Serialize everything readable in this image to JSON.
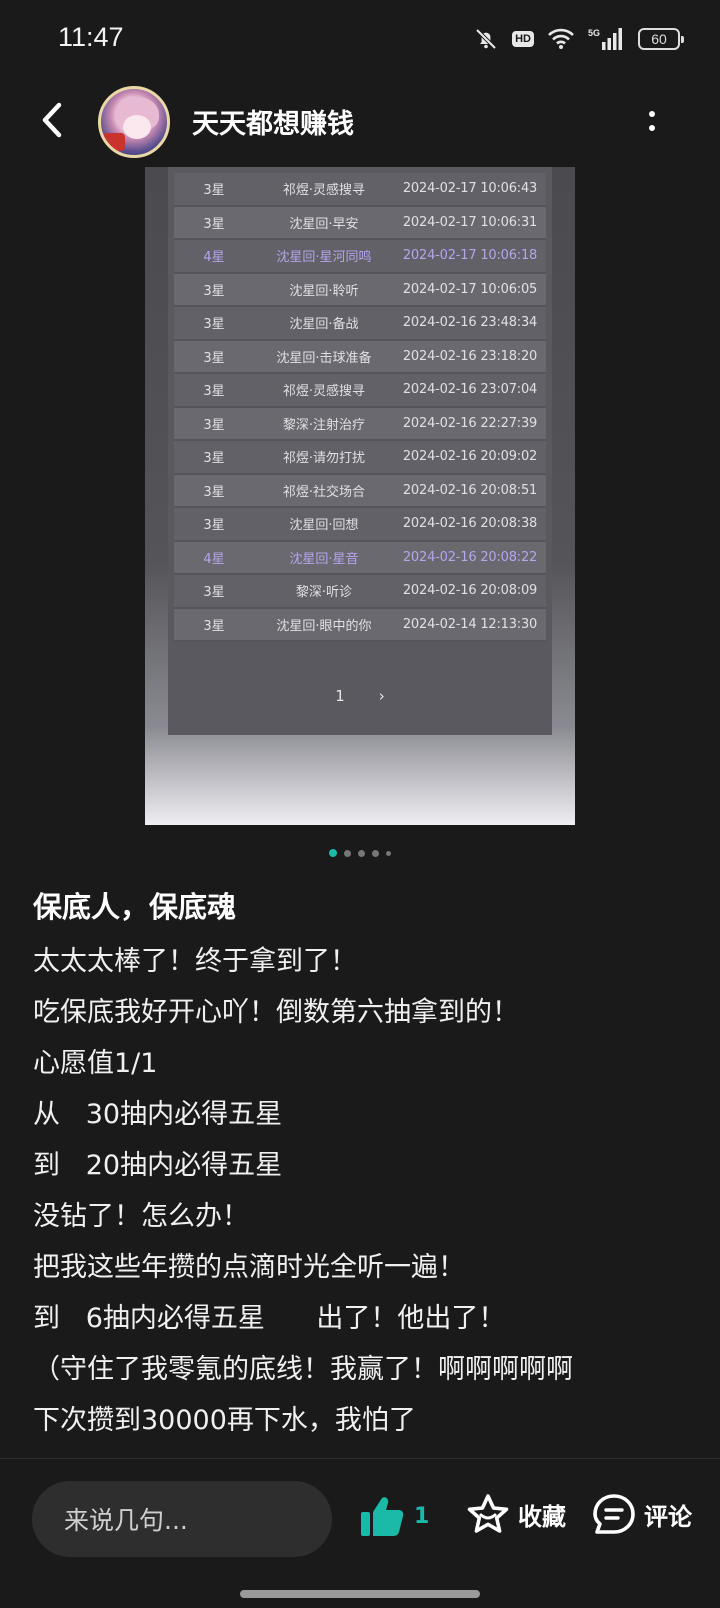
{
  "status_bar": {
    "time": "11:47",
    "hd": "HD",
    "network": "5G",
    "battery": "60"
  },
  "header": {
    "username": "天天都想赚钱"
  },
  "records": [
    {
      "star": "3星",
      "name": "祁煜·灵感搜寻",
      "time": "2024-02-17 10:06:43",
      "four": false
    },
    {
      "star": "3星",
      "name": "沈星回·早安",
      "time": "2024-02-17 10:06:31",
      "four": false
    },
    {
      "star": "4星",
      "name": "沈星回·星河同鸣",
      "time": "2024-02-17 10:06:18",
      "four": true
    },
    {
      "star": "3星",
      "name": "沈星回·聆听",
      "time": "2024-02-17 10:06:05",
      "four": false
    },
    {
      "star": "3星",
      "name": "沈星回·备战",
      "time": "2024-02-16 23:48:34",
      "four": false
    },
    {
      "star": "3星",
      "name": "沈星回·击球准备",
      "time": "2024-02-16 23:18:20",
      "four": false
    },
    {
      "star": "3星",
      "name": "祁煜·灵感搜寻",
      "time": "2024-02-16 23:07:04",
      "four": false
    },
    {
      "star": "3星",
      "name": "黎深·注射治疗",
      "time": "2024-02-16 22:27:39",
      "four": false
    },
    {
      "star": "3星",
      "name": "祁煜·请勿打扰",
      "time": "2024-02-16 20:09:02",
      "four": false
    },
    {
      "star": "3星",
      "name": "祁煜·社交场合",
      "time": "2024-02-16 20:08:51",
      "four": false
    },
    {
      "star": "3星",
      "name": "沈星回·回想",
      "time": "2024-02-16 20:08:38",
      "four": false
    },
    {
      "star": "4星",
      "name": "沈星回·星音",
      "time": "2024-02-16 20:08:22",
      "four": true
    },
    {
      "star": "3星",
      "name": "黎深·听诊",
      "time": "2024-02-16 20:08:09",
      "four": false
    },
    {
      "star": "3星",
      "name": "沈星回·眼中的你",
      "time": "2024-02-14 12:13:30",
      "four": false
    }
  ],
  "pager": {
    "page": "1",
    "next": "›"
  },
  "carousel": {
    "count": 5,
    "active": 0
  },
  "post": {
    "title": "保底人，保底魂",
    "lines": [
      "太太太棒了！终于拿到了！",
      "吃保底我好开心吖！倒数第六抽拿到的！",
      "心愿值1/1",
      "从   30抽内必得五星",
      "到   20抽内必得五星",
      "没钻了！怎么办！",
      "把我这些年攒的点滴时光全听一遍！",
      "到   6抽内必得五星      出了！他出了！",
      "（守住了我零氪的底线！我赢了！啊啊啊啊啊",
      "下次攒到30000再下水，我怕了"
    ]
  },
  "bottom_bar": {
    "comment_placeholder": "来说几句...",
    "like_count": "1",
    "favorite_label": "收藏",
    "comment_label": "评论"
  },
  "colors": {
    "accent": "#1bb9a8",
    "four_star": "#b6a4ec",
    "background": "#1a1a1a"
  }
}
